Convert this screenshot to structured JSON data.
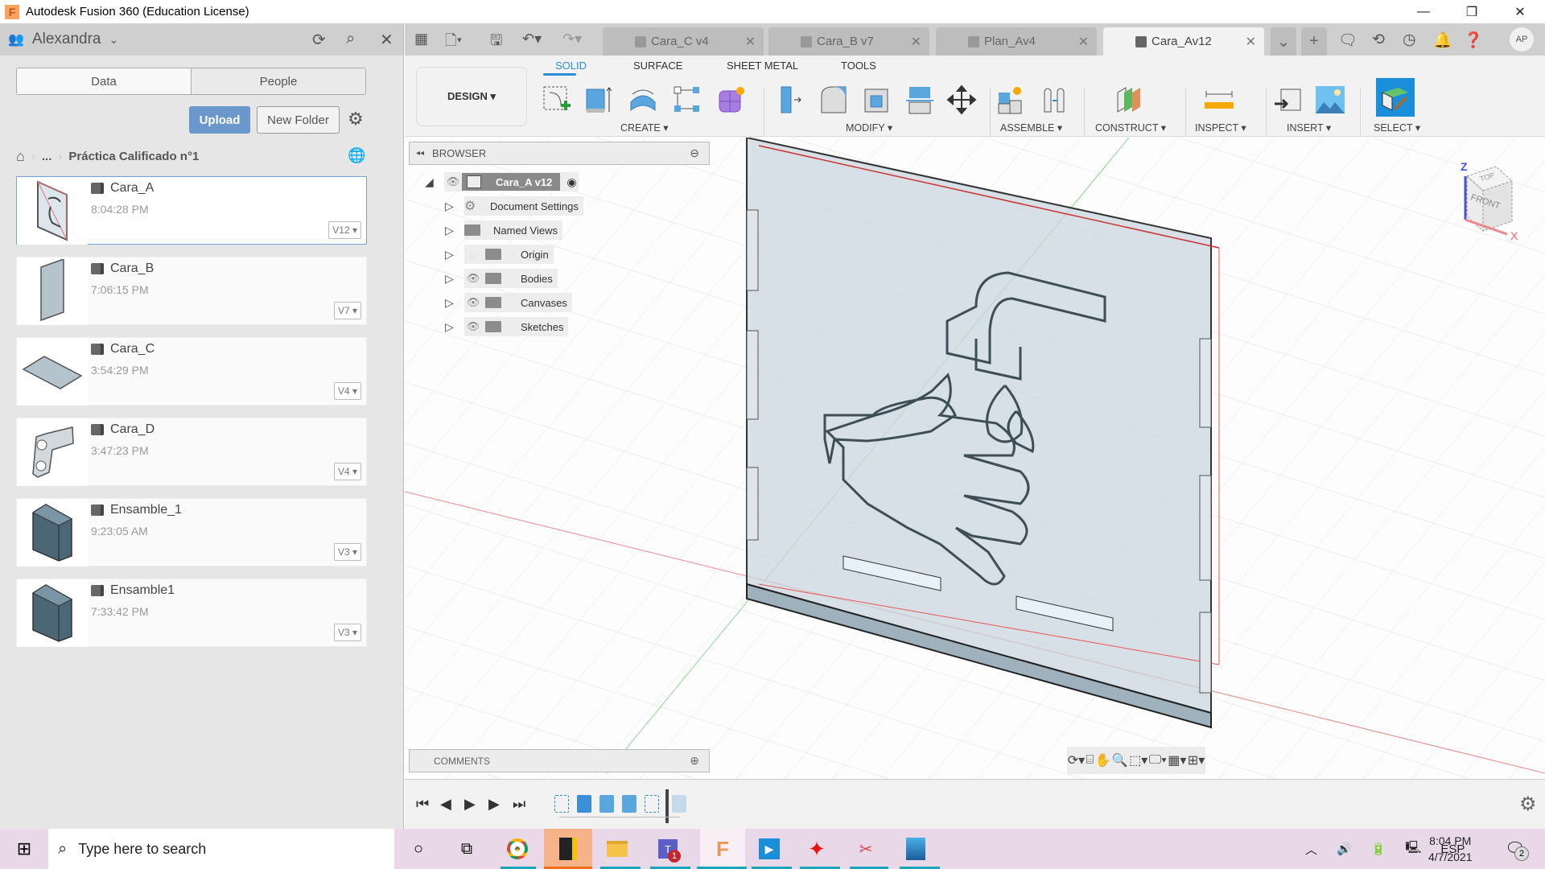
{
  "window": {
    "title": "Autodesk Fusion 360 (Education License)",
    "controls": {
      "minimize": "—",
      "restore": "❐",
      "close": "✕"
    }
  },
  "sidebar": {
    "user": "Alexandra",
    "tabs": [
      {
        "label": "Data",
        "active": true
      },
      {
        "label": "People",
        "active": false
      }
    ],
    "upload_label": "Upload",
    "new_folder_label": "New Folder",
    "breadcrumb": {
      "ellipsis": "...",
      "current": "Práctica Calificado n°1"
    },
    "files": [
      {
        "name": "Cara_A",
        "time": "8:04:28 PM",
        "version": "V12",
        "selected": true
      },
      {
        "name": "Cara_B",
        "time": "7:06:15 PM",
        "version": "V7",
        "selected": false
      },
      {
        "name": "Cara_C",
        "time": "3:54:29 PM",
        "version": "V4",
        "selected": false
      },
      {
        "name": "Cara_D",
        "time": "3:47:23 PM",
        "version": "V4",
        "selected": false
      },
      {
        "name": "Ensamble_1",
        "time": "9:23:05 AM",
        "version": "V3",
        "selected": false
      },
      {
        "name": "Ensamble1",
        "time": "7:33:42 PM",
        "version": "V3",
        "selected": false
      }
    ]
  },
  "doc_tabs": [
    {
      "label": "Cara_C v4",
      "active": false
    },
    {
      "label": "Cara_B v7",
      "active": false
    },
    {
      "label": "Plan_Av4",
      "active": false
    },
    {
      "label": "Cara_Av12",
      "active": true
    }
  ],
  "user_initials": "AP",
  "toolbar": {
    "workspace": "DESIGN ▾",
    "workspace_tabs": [
      {
        "label": "SOLID",
        "active": true
      },
      {
        "label": "SURFACE",
        "active": false
      },
      {
        "label": "SHEET METAL",
        "active": false
      },
      {
        "label": "TOOLS",
        "active": false
      }
    ],
    "groups": [
      {
        "label": "CREATE ▾"
      },
      {
        "label": "MODIFY ▾"
      },
      {
        "label": "ASSEMBLE ▾"
      },
      {
        "label": "CONSTRUCT ▾"
      },
      {
        "label": "INSPECT ▾"
      },
      {
        "label": "INSERT ▾"
      },
      {
        "label": "SELECT ▾"
      }
    ]
  },
  "browser": {
    "title": "BROWSER",
    "root": "Cara_A v12",
    "items": [
      {
        "label": "Document Settings",
        "icon": "gear-icon"
      },
      {
        "label": "Named Views",
        "icon": "folder-icon"
      },
      {
        "label": "Origin",
        "icon": "folder-icon",
        "visible": false
      },
      {
        "label": "Bodies",
        "icon": "folder-icon",
        "visible": true
      },
      {
        "label": "Canvases",
        "icon": "folder-icon",
        "visible": true
      },
      {
        "label": "Sketches",
        "icon": "folder-icon",
        "visible": true
      }
    ]
  },
  "comments": {
    "title": "COMMENTS"
  },
  "viewcube": {
    "top": "TOP",
    "front": "FRONT",
    "axis_z": "Z",
    "axis_x": "X"
  },
  "taskbar": {
    "search_placeholder": "Type here to search",
    "language": "ESP",
    "time": "8:04 PM",
    "date": "4/7/2021",
    "notifications": "2",
    "teams_badge": "1"
  }
}
